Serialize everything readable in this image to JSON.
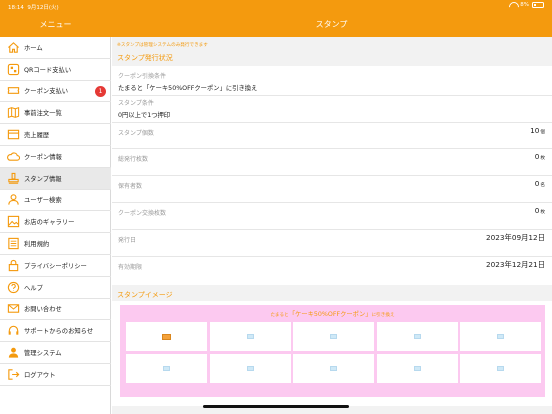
{
  "status_bar": {
    "time": "18:14",
    "date": "9月12日(火)",
    "battery": "8%"
  },
  "header": {
    "sidebar_title": "メニュー",
    "main_title": "スタンプ"
  },
  "sidebar": {
    "items": [
      {
        "label": "ホーム",
        "icon": "home-icon"
      },
      {
        "label": "QRコード支払い",
        "icon": "qr-code-icon"
      },
      {
        "label": "クーポン支払い",
        "icon": "coupon-icon",
        "badge": "1"
      },
      {
        "label": "事前注文一覧",
        "icon": "map-icon"
      },
      {
        "label": "売上履歴",
        "icon": "sales-history-icon"
      },
      {
        "label": "クーポン情報",
        "icon": "coupon-info-icon"
      },
      {
        "label": "スタンプ情報",
        "icon": "stamp-icon"
      },
      {
        "label": "ユーザー検索",
        "icon": "user-search-icon"
      },
      {
        "label": "お店のギャラリー",
        "icon": "gallery-icon"
      },
      {
        "label": "利用規約",
        "icon": "terms-icon"
      },
      {
        "label": "プライバシーポリシー",
        "icon": "privacy-lock-icon"
      },
      {
        "label": "ヘルプ",
        "icon": "help-icon"
      },
      {
        "label": "お問い合わせ",
        "icon": "mail-icon"
      },
      {
        "label": "サポートからのお知らせ",
        "icon": "headset-icon"
      },
      {
        "label": "管理システム",
        "icon": "admin-user-icon"
      },
      {
        "label": "ログアウト",
        "icon": "logout-icon"
      }
    ],
    "active_index": 6
  },
  "main": {
    "note": "※スタンプは管理システムのみ発行できます",
    "status_title": "スタンプ発行状況",
    "exchange_label": "クーポン引換条件",
    "exchange_value": "たまると「ケーキ50%OFFクーポン」に引き換え",
    "condition_label": "スタンプ条件",
    "condition_value": "0円以上で1つ押印",
    "rows": [
      {
        "label": "スタンプ個数",
        "value": "10",
        "unit": "個"
      },
      {
        "label": "総発行枚数",
        "value": "0",
        "unit": "枚"
      },
      {
        "label": "保有者数",
        "value": "0",
        "unit": "名"
      },
      {
        "label": "クーポン交換枚数",
        "value": "0",
        "unit": "枚"
      },
      {
        "label": "発行日",
        "value": "2023年09月12日",
        "unit": ""
      },
      {
        "label": "有効期限",
        "value": "2023年12月21日",
        "unit": ""
      }
    ],
    "image_title": "スタンプイメージ",
    "image_caption_pre": "たまると",
    "image_caption_coupon": "「ケーキ50%OFFクーポン」",
    "image_caption_post": "に引き換え",
    "stamp_slots": 10,
    "stamped_count": 1
  },
  "colors": {
    "accent": "#f49a0e",
    "stamp_card_bg": "#fcc9f0",
    "badge": "#e53935"
  }
}
